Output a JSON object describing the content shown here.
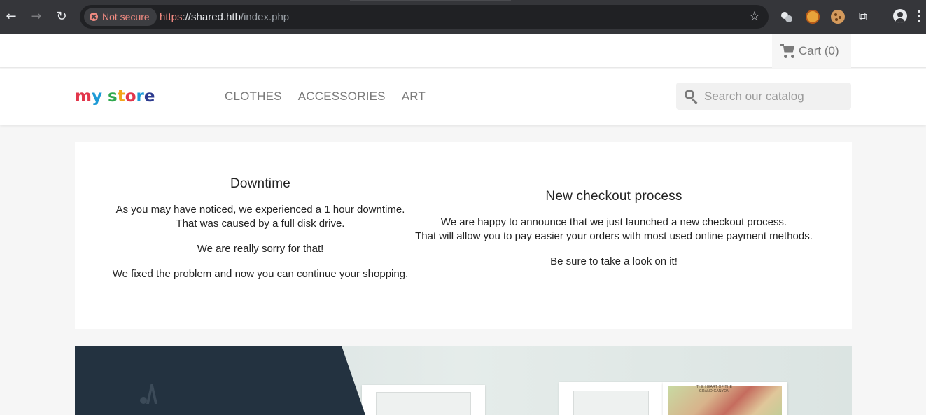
{
  "browser": {
    "security_label": "Not secure",
    "url_scheme": "https",
    "url_host": "://shared.htb",
    "url_path": "/index.php",
    "icons": [
      "back-icon",
      "forward-icon",
      "reload-icon",
      "bookmark-star-icon",
      "extension-icon",
      "profile-icon",
      "menu-icon"
    ],
    "back_glyph": "←",
    "forward_glyph": "→",
    "reload_glyph": "↻",
    "star_glyph": "☆",
    "puzzle_glyph": "⧉"
  },
  "header": {
    "cart_label": "Cart (0)",
    "logo": [
      "m",
      "y",
      " ",
      "s",
      "t",
      "o",
      "r",
      "e"
    ],
    "nav": [
      "CLOTHES",
      "ACCESSORIES",
      "ART"
    ],
    "search_placeholder": "Search our catalog"
  },
  "news": {
    "left": {
      "title": "Downtime",
      "paragraphs": [
        "As you may have noticed, we experienced a 1 hour downtime.",
        "That was caused by a full disk drive.",
        "We are really sorry for that!",
        "We fixed the problem and now you can continue your shopping."
      ]
    },
    "right": {
      "title": "New checkout process",
      "paragraphs": [
        "We are happy to announce that we just launched a new checkout process.",
        "That will allow you to pay easier your orders with most used online payment methods.",
        "Be sure to take a look on it!"
      ]
    }
  },
  "hero": {
    "map_title_line1": "THE HEART OF THE",
    "map_title_line2": "GRAND CANYON"
  },
  "colors": {
    "browser_bg": "#35363a",
    "omnibox_bg": "#202124",
    "not_secure": "#f28b82",
    "hero_dark": "#233240",
    "nav_text": "#7a7a7a"
  }
}
